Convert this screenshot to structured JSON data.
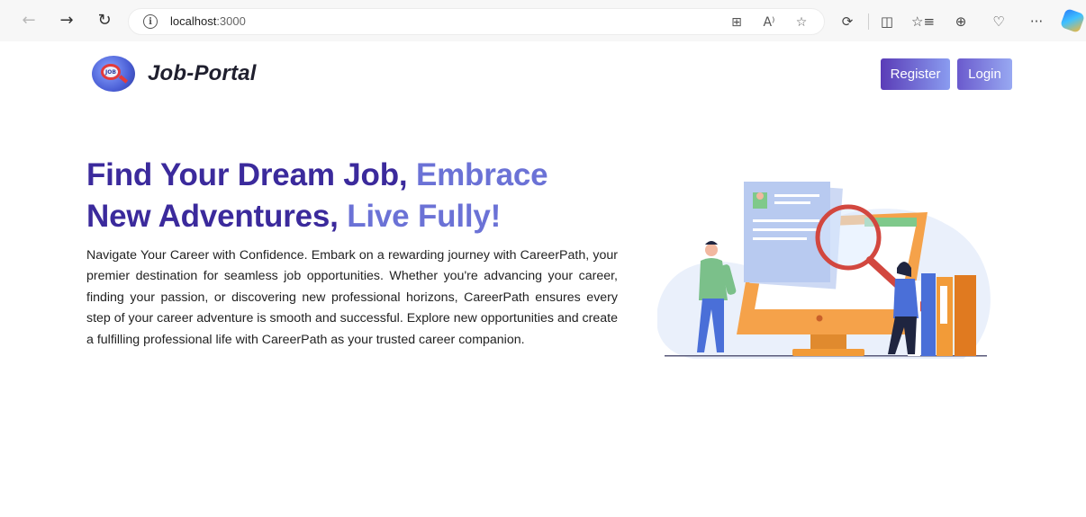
{
  "browser": {
    "url_host": "localhost",
    "url_port": ":3000",
    "icons": {
      "back": "arrow-left-icon",
      "forward": "arrow-right-icon",
      "refresh": "refresh-icon",
      "info": "info-icon",
      "app": "app-grid-icon",
      "read_aloud": "read-aloud-icon",
      "favorite": "star-icon",
      "extensions": "puzzle-icon",
      "split": "split-screen-icon",
      "favorites": "favorites-list-icon",
      "collections": "collections-icon",
      "performance": "heart-pulse-icon",
      "more": "more-icon",
      "copilot": "copilot-icon"
    },
    "glyphs": {
      "back": "←",
      "forward": "→",
      "refresh": "↻",
      "info": "i",
      "app": "⊞",
      "read_aloud": "A⁾",
      "favorite": "☆",
      "extensions": "⟳",
      "split": "◫",
      "favorites": "☆≡",
      "collections": "⊕",
      "performance": "♡",
      "more": "···"
    }
  },
  "header": {
    "brand": "Job-Portal",
    "logo_text": "JOB",
    "register_label": "Register",
    "login_label": "Login"
  },
  "hero": {
    "headline_part1": "Find Your Dream Job, ",
    "headline_part2": "Embrace",
    "headline_part3": "New Adventures, ",
    "headline_part4": "Live Fully!",
    "description": "Navigate Your Career with Confidence. Embark on a rewarding journey with CareerPath, your premier destination for seamless job opportunities. Whether you're advancing your career, finding your passion, or discovering new professional horizons, CareerPath ensures every step of your career adventure is smooth and successful. Explore new opportunities and create a fulfilling professional life with CareerPath as your trusted career companion."
  },
  "colors": {
    "headline_dark": "#3b2a9c",
    "headline_light": "#6b72d6",
    "button_start": "#5a3cb7",
    "button_end": "#8a9cf0"
  }
}
